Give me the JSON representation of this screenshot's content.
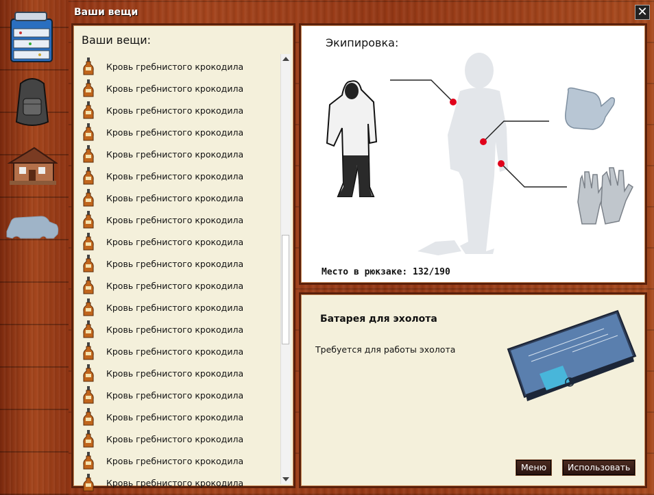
{
  "window": {
    "title": "Ваши вещи",
    "close_glyph": "✕"
  },
  "sidebar": {
    "items": [
      {
        "name": "tackle-box-icon"
      },
      {
        "name": "backpack-icon"
      },
      {
        "name": "house-icon"
      },
      {
        "name": "car-icon"
      }
    ]
  },
  "inventory": {
    "heading": "Ваши вещи:",
    "item_icon": "bottle-icon",
    "items": [
      "Кровь гребнистого крокодила",
      "Кровь гребнистого крокодила",
      "Кровь гребнистого крокодила",
      "Кровь гребнистого крокодила",
      "Кровь гребнистого крокодила",
      "Кровь гребнистого крокодила",
      "Кровь гребнистого крокодила",
      "Кровь гребнистого крокодила",
      "Кровь гребнистого крокодила",
      "Кровь гребнистого крокодила",
      "Кровь гребнистого крокодила",
      "Кровь гребнистого крокодила",
      "Кровь гребнистого крокодила",
      "Кровь гребнистого крокодила",
      "Кровь гребнистого крокодила",
      "Кровь гребнистого крокодила",
      "Кровь гребнистого крокодила",
      "Кровь гребнистого крокодила",
      "Кровь гребнистого крокодила",
      "Кровь гребнистого крокодила"
    ]
  },
  "equipment": {
    "heading": "Экипировка:",
    "space_label": "Место в рюкзаке: 132/190",
    "slots": [
      "suit-icon",
      "mitten-icon",
      "gloves-icon"
    ]
  },
  "details": {
    "item_name": "Батарея для эхолота",
    "description": "Требуется для работы эхолота",
    "image": "battery-icon",
    "menu_button": "Меню",
    "use_button": "Использовать"
  },
  "colors": {
    "marker": "#e0001a",
    "wood": "#a4441c",
    "panel_bg": "#f4f0db"
  }
}
